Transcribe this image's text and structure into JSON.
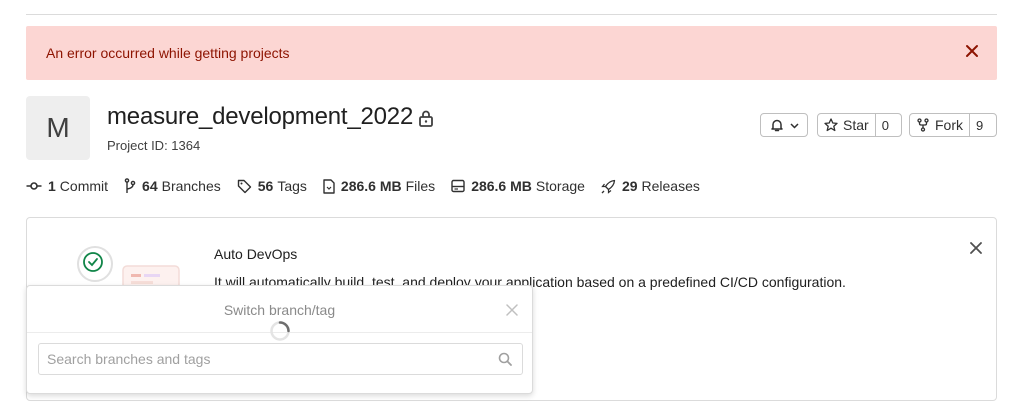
{
  "alert": {
    "message": "An error occurred while getting projects"
  },
  "project": {
    "avatar_letter": "M",
    "name": "measure_development_2022",
    "id_text": "Project ID: 1364"
  },
  "actions": {
    "star_label": "Star",
    "star_count": "0",
    "fork_label": "Fork",
    "fork_count": "9"
  },
  "stats": [
    {
      "icon": "commit-icon",
      "count": "1",
      "label": "Commit"
    },
    {
      "icon": "branch-icon",
      "count": "64",
      "label": "Branches"
    },
    {
      "icon": "tag-icon",
      "count": "56",
      "label": "Tags"
    },
    {
      "icon": "file-icon",
      "count": "286.6 MB",
      "label": "Files"
    },
    {
      "icon": "storage-icon",
      "count": "286.6 MB",
      "label": "Storage"
    },
    {
      "icon": "rocket-icon",
      "count": "29",
      "label": "Releases"
    }
  ],
  "autodevops": {
    "title": "Auto DevOps",
    "description": "It will automatically build, test, and deploy your application based on a predefined CI/CD configuration."
  },
  "branch_dropdown": {
    "title": "Switch branch/tag",
    "search_placeholder": "Search branches and tags"
  },
  "colors": {
    "alert_bg": "#fcd6d3",
    "alert_text": "#8d1300",
    "success": "#108548"
  }
}
